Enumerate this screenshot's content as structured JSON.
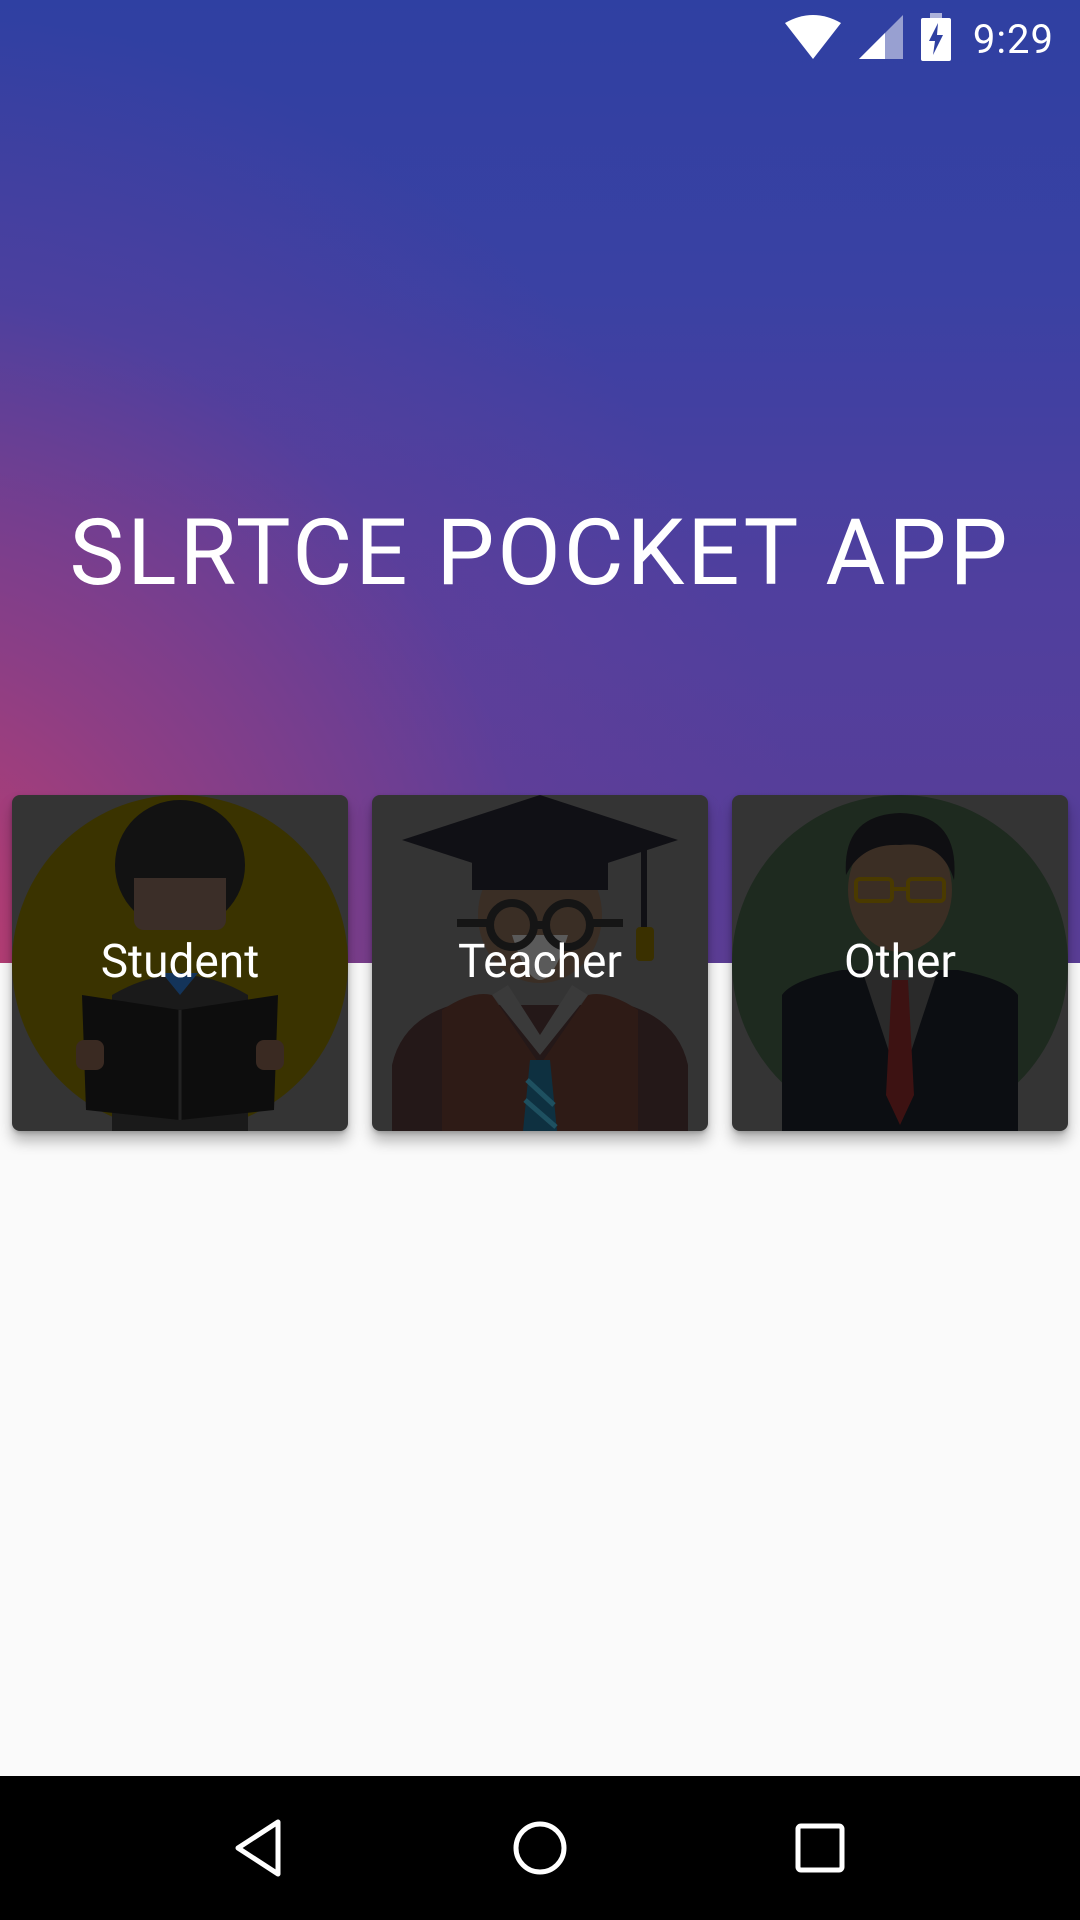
{
  "status_bar": {
    "time": "9:29",
    "icons": [
      "wifi-icon",
      "cell-signal-icon",
      "battery-charging-icon"
    ]
  },
  "app": {
    "title": "SLRTCE POCKET APP"
  },
  "cards": [
    {
      "label": "Student",
      "icon": "student-reading-icon",
      "circle_color": "#3a3300"
    },
    {
      "label": "Teacher",
      "icon": "teacher-graduation-cap-icon",
      "circle_color": "#343434"
    },
    {
      "label": "Other",
      "icon": "businessman-icon",
      "circle_color": "#1e2a1f"
    }
  ],
  "nav": {
    "buttons": [
      "back-icon",
      "home-icon",
      "recents-icon"
    ]
  },
  "colors": {
    "header_top": "#2f40a2",
    "header_accent": "#cd3c69",
    "background": "#fafafa",
    "card": "#343434",
    "nav_bar": "#000000"
  }
}
